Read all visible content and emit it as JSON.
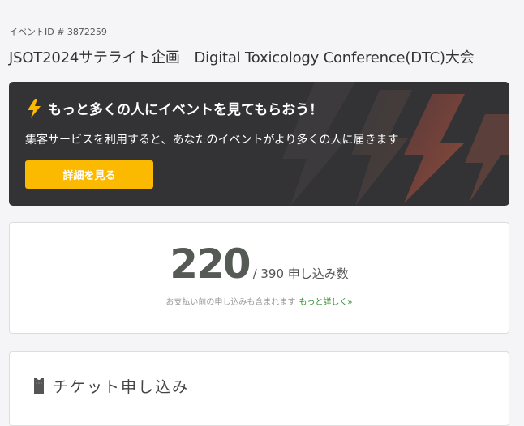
{
  "event": {
    "id_label": "イベントID # 3872259",
    "title": "JSOT2024サテライト企画　Digital Toxicology Conference(DTC)大会"
  },
  "promo": {
    "icon": "lightning-icon",
    "title": "もっと多くの人にイベントを見てもらおう！",
    "subtitle": "集客サービスを利用すると、あなたのイベントがより多くの人に届きます",
    "button_label": "詳細を見る",
    "accent_color": "#fbb900",
    "background_color": "#333336"
  },
  "registrations": {
    "count": "220",
    "total_label": "/ 390 申し込み数",
    "note": "お支払い前の申し込みも含まれます",
    "more_link": "もっと詳しく»"
  },
  "ticket_section": {
    "icon": "ticket-icon",
    "title": "チケット申し込み"
  }
}
